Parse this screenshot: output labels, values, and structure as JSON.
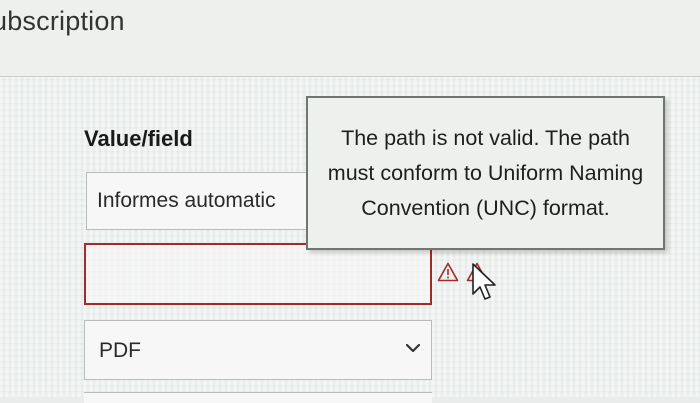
{
  "page": {
    "title": "ubscription"
  },
  "form": {
    "field_label": "Value/field",
    "text_input_value": "Informes automatic",
    "path_input_value": "",
    "format_select": {
      "selected": "PDF"
    }
  },
  "tooltip": {
    "message": "The path is not valid. The path must conform to Uniform Naming Convention (UNC) format."
  },
  "icons": {
    "warning": "warning-icon",
    "cursor": "mouse-pointer-icon",
    "chevron": "chevron-down-icon"
  },
  "colors": {
    "error_border": "#a32a2a",
    "tooltip_border": "#6f7570"
  }
}
